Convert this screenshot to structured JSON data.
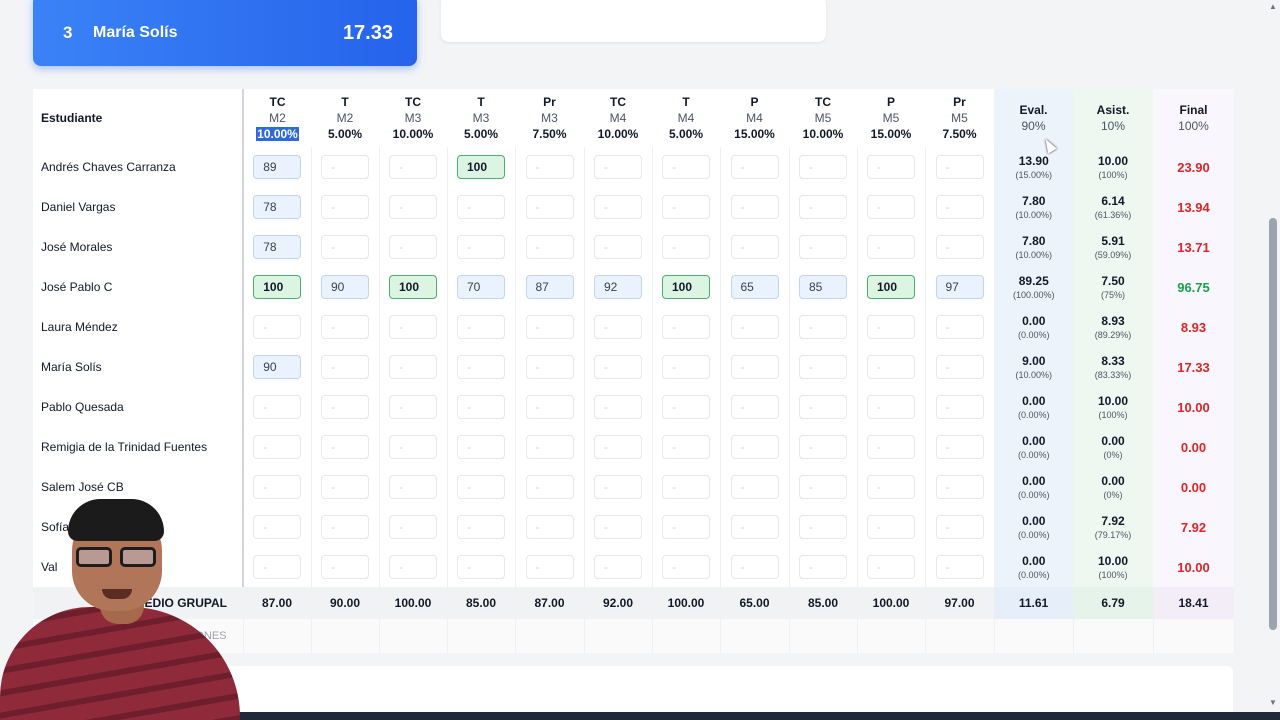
{
  "ranking_card": {
    "position": "3",
    "name": "María Solís",
    "score": "17.33"
  },
  "table": {
    "student_header": "Estudiante",
    "assessments": [
      {
        "type": "TC",
        "module": "M2",
        "weight": "10.00%",
        "selected": true
      },
      {
        "type": "T",
        "module": "M2",
        "weight": "5.00%"
      },
      {
        "type": "TC",
        "module": "M3",
        "weight": "10.00%"
      },
      {
        "type": "T",
        "module": "M3",
        "weight": "5.00%"
      },
      {
        "type": "Pr",
        "module": "M3",
        "weight": "7.50%"
      },
      {
        "type": "TC",
        "module": "M4",
        "weight": "10.00%"
      },
      {
        "type": "T",
        "module": "M4",
        "weight": "5.00%"
      },
      {
        "type": "P",
        "module": "M4",
        "weight": "15.00%"
      },
      {
        "type": "TC",
        "module": "M5",
        "weight": "10.00%"
      },
      {
        "type": "P",
        "module": "M5",
        "weight": "15.00%"
      },
      {
        "type": "Pr",
        "module": "M5",
        "weight": "7.50%"
      }
    ],
    "summary_headers": {
      "eval": {
        "label": "Eval.",
        "sub": "90%"
      },
      "asist": {
        "label": "Asist.",
        "sub": "10%"
      },
      "final": {
        "label": "Final",
        "sub": "100%"
      }
    },
    "empty_placeholder": "-",
    "rows": [
      {
        "name": "Andrés Chaves Carranza",
        "grades": [
          "89",
          "",
          "",
          "100",
          "",
          "",
          "",
          "",
          "",
          "",
          ""
        ],
        "eval": "13.90",
        "eval_pct": "(15.00%)",
        "asist": "10.00",
        "asist_pct": "(100%)",
        "final": "23.90",
        "final_status": "red"
      },
      {
        "name": "Daniel Vargas",
        "grades": [
          "78",
          "",
          "",
          "",
          "",
          "",
          "",
          "",
          "",
          "",
          ""
        ],
        "eval": "7.80",
        "eval_pct": "(10.00%)",
        "asist": "6.14",
        "asist_pct": "(61.36%)",
        "final": "13.94",
        "final_status": "red"
      },
      {
        "name": "José Morales",
        "grades": [
          "78",
          "",
          "",
          "",
          "",
          "",
          "",
          "",
          "",
          "",
          ""
        ],
        "eval": "7.80",
        "eval_pct": "(10.00%)",
        "asist": "5.91",
        "asist_pct": "(59.09%)",
        "final": "13.71",
        "final_status": "red"
      },
      {
        "name": "José Pablo C",
        "grades": [
          "100",
          "90",
          "100",
          "70",
          "87",
          "92",
          "100",
          "65",
          "85",
          "100",
          "97"
        ],
        "eval": "89.25",
        "eval_pct": "(100.00%)",
        "asist": "7.50",
        "asist_pct": "(75%)",
        "final": "96.75",
        "final_status": "green"
      },
      {
        "name": "Laura Méndez",
        "grades": [
          "",
          "",
          "",
          "",
          "",
          "",
          "",
          "",
          "",
          "",
          ""
        ],
        "eval": "0.00",
        "eval_pct": "(0.00%)",
        "asist": "8.93",
        "asist_pct": "(89.29%)",
        "final": "8.93",
        "final_status": "red"
      },
      {
        "name": "María Solís",
        "grades": [
          "90",
          "",
          "",
          "",
          "",
          "",
          "",
          "",
          "",
          "",
          ""
        ],
        "eval": "9.00",
        "eval_pct": "(10.00%)",
        "asist": "8.33",
        "asist_pct": "(83.33%)",
        "final": "17.33",
        "final_status": "red"
      },
      {
        "name": "Pablo Quesada",
        "grades": [
          "",
          "",
          "",
          "",
          "",
          "",
          "",
          "",
          "",
          "",
          ""
        ],
        "eval": "0.00",
        "eval_pct": "(0.00%)",
        "asist": "10.00",
        "asist_pct": "(100%)",
        "final": "10.00",
        "final_status": "red"
      },
      {
        "name": "Remigia de la Trinidad Fuentes",
        "grades": [
          "",
          "",
          "",
          "",
          "",
          "",
          "",
          "",
          "",
          "",
          ""
        ],
        "eval": "0.00",
        "eval_pct": "(0.00%)",
        "asist": "0.00",
        "asist_pct": "(0%)",
        "final": "0.00",
        "final_status": "red"
      },
      {
        "name": "Salem José CB",
        "grades": [
          "",
          "",
          "",
          "",
          "",
          "",
          "",
          "",
          "",
          "",
          ""
        ],
        "eval": "0.00",
        "eval_pct": "(0.00%)",
        "asist": "0.00",
        "asist_pct": "(0%)",
        "final": "0.00",
        "final_status": "red"
      },
      {
        "name": "Sofía J",
        "grades": [
          "",
          "",
          "",
          "",
          "",
          "",
          "",
          "",
          "",
          "",
          ""
        ],
        "eval": "0.00",
        "eval_pct": "(0.00%)",
        "asist": "7.92",
        "asist_pct": "(79.17%)",
        "final": "7.92",
        "final_status": "red"
      },
      {
        "name": "Val",
        "grades": [
          "",
          "",
          "",
          "",
          "",
          "",
          "",
          "",
          "",
          "",
          ""
        ],
        "eval": "0.00",
        "eval_pct": "(0.00%)",
        "asist": "10.00",
        "asist_pct": "(100%)",
        "final": "10.00",
        "final_status": "red"
      }
    ],
    "average_row": {
      "label": "EDIO GRUPAL",
      "values": [
        "87.00",
        "90.00",
        "100.00",
        "85.00",
        "87.00",
        "92.00",
        "100.00",
        "65.00",
        "85.00",
        "100.00",
        "97.00"
      ],
      "eval": "11.61",
      "asist": "6.79",
      "final": "18.41"
    },
    "extra_row_label": "ONES"
  },
  "colors": {
    "accent": "#2563eb",
    "full_score_border": "#4caf6e",
    "fail": "#dc2626",
    "pass": "#16a34a"
  }
}
